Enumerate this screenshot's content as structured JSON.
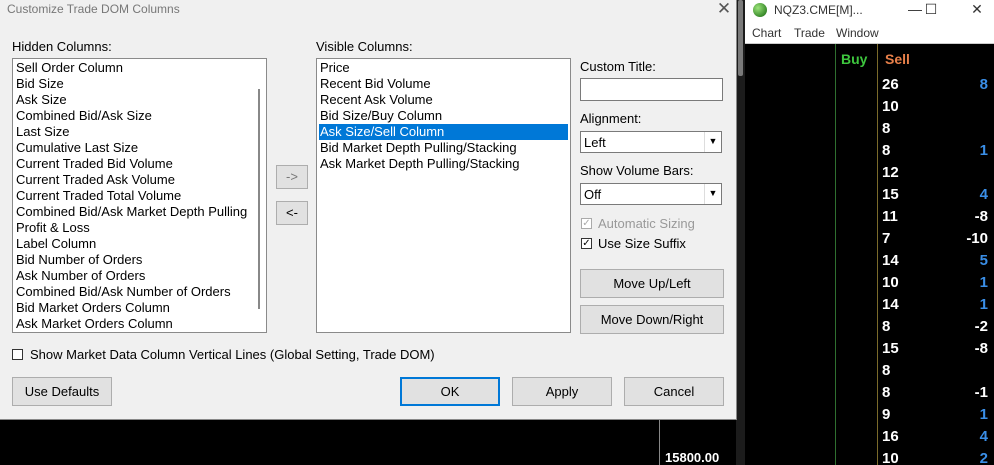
{
  "dialog": {
    "title": "Customize Trade DOM Columns",
    "close_glyph": "✕",
    "hidden_label": "Hidden Columns:",
    "visible_label": "Visible Columns:",
    "hidden_items": [
      "Sell Order Column",
      "Bid Size",
      "Ask Size",
      "Combined Bid/Ask Size",
      "Last Size",
      "Cumulative Last Size",
      "Current Traded Bid Volume",
      "Current Traded Ask Volume",
      "Current Traded Total Volume",
      "Combined Bid/Ask Market Depth Pulling",
      "Profit & Loss",
      "Label Column",
      "Bid Number of Orders",
      "Ask Number of Orders",
      "Combined Bid/Ask Number of Orders",
      "Bid Market Orders Column",
      "Ask Market Orders Column"
    ],
    "visible_items": [
      "Price",
      "Recent Bid Volume",
      "Recent Ask Volume",
      "Bid Size/Buy Column",
      "Ask Size/Sell Column",
      "Bid Market Depth Pulling/Stacking",
      "Ask Market Depth Pulling/Stacking"
    ],
    "visible_selected_index": 4,
    "move_right_label": "->",
    "move_left_label": "<-",
    "custom_title_label": "Custom Title:",
    "custom_title_value": "",
    "alignment_label": "Alignment:",
    "alignment_value": "Left",
    "volume_bars_label": "Show Volume Bars:",
    "volume_bars_value": "Off",
    "automatic_sizing_label": "Automatic Sizing",
    "automatic_sizing_checked": true,
    "automatic_sizing_enabled": false,
    "size_suffix_label": "Use Size Suffix",
    "size_suffix_checked": true,
    "move_up_label": "Move Up/Left",
    "move_down_label": "Move Down/Right",
    "vertical_lines_label": "Show Market Data Column Vertical Lines (Global Setting, Trade DOM)",
    "vertical_lines_checked": false,
    "use_defaults_label": "Use Defaults",
    "ok_label": "OK",
    "apply_label": "Apply",
    "cancel_label": "Cancel"
  },
  "dom_window": {
    "title": "NQZ3.CME[M]...",
    "minimize_glyph": "—",
    "maximize_glyph": "☐",
    "close_glyph": "✕",
    "menu": [
      "Chart",
      "Trade",
      "Window"
    ],
    "buy_header": "Buy",
    "sell_header": "Sell",
    "buy_color": "#3ec63e",
    "sell_color": "#e8804a",
    "sell_values": [
      "26",
      "10",
      "8",
      "8",
      "12",
      "15",
      "11",
      "7",
      "14",
      "10",
      "14",
      "8",
      "15",
      "8",
      "8",
      "9",
      "16",
      "10"
    ],
    "right_values": [
      "8",
      "",
      "",
      "1",
      "",
      "4",
      "-8",
      "-10",
      "5",
      "1",
      "1",
      "-2",
      "-8",
      "",
      "-1",
      "1",
      "4",
      "2"
    ],
    "right_colors": [
      "#3a8ee6",
      "",
      "",
      "#3a8ee6",
      "",
      "#3a8ee6",
      "#ffffff",
      "#ffffff",
      "#3a8ee6",
      "#3a8ee6",
      "#3a8ee6",
      "#ffffff",
      "#ffffff",
      "",
      "#ffffff",
      "#3a8ee6",
      "#3a8ee6",
      "#3a8ee6"
    ]
  },
  "chart": {
    "price_label": "15800.00"
  }
}
